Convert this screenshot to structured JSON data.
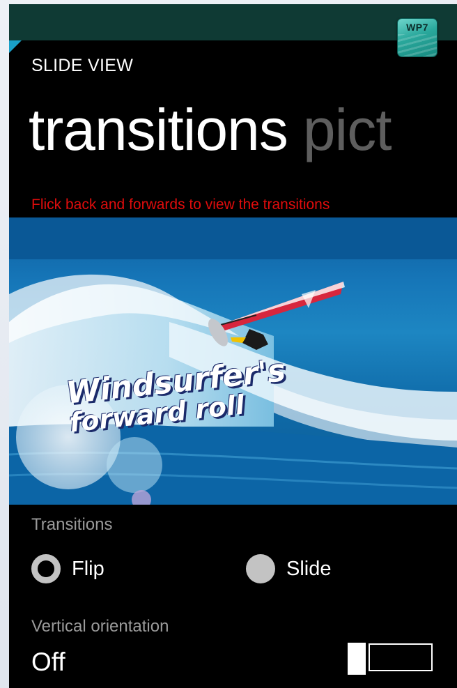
{
  "header": {
    "badge_text": "WP7",
    "app_title": "SLIDE VIEW"
  },
  "pivot": {
    "items": [
      {
        "label": "transitions",
        "active": true
      },
      {
        "label": "pict",
        "active": false
      }
    ]
  },
  "hint_text": "Flick back and forwards to view the transitions",
  "slide": {
    "caption_line1": "Windsurfer's",
    "caption_line2": "forward roll"
  },
  "transitions": {
    "label": "Transitions",
    "options": [
      {
        "label": "Flip",
        "checked": true
      },
      {
        "label": "Slide",
        "checked": false
      }
    ]
  },
  "vertical_orientation": {
    "label": "Vertical orientation",
    "value": "Off"
  },
  "colors": {
    "accent": "#19a0c8",
    "hint": "#e00c0c",
    "topbar": "#0f3a34"
  }
}
